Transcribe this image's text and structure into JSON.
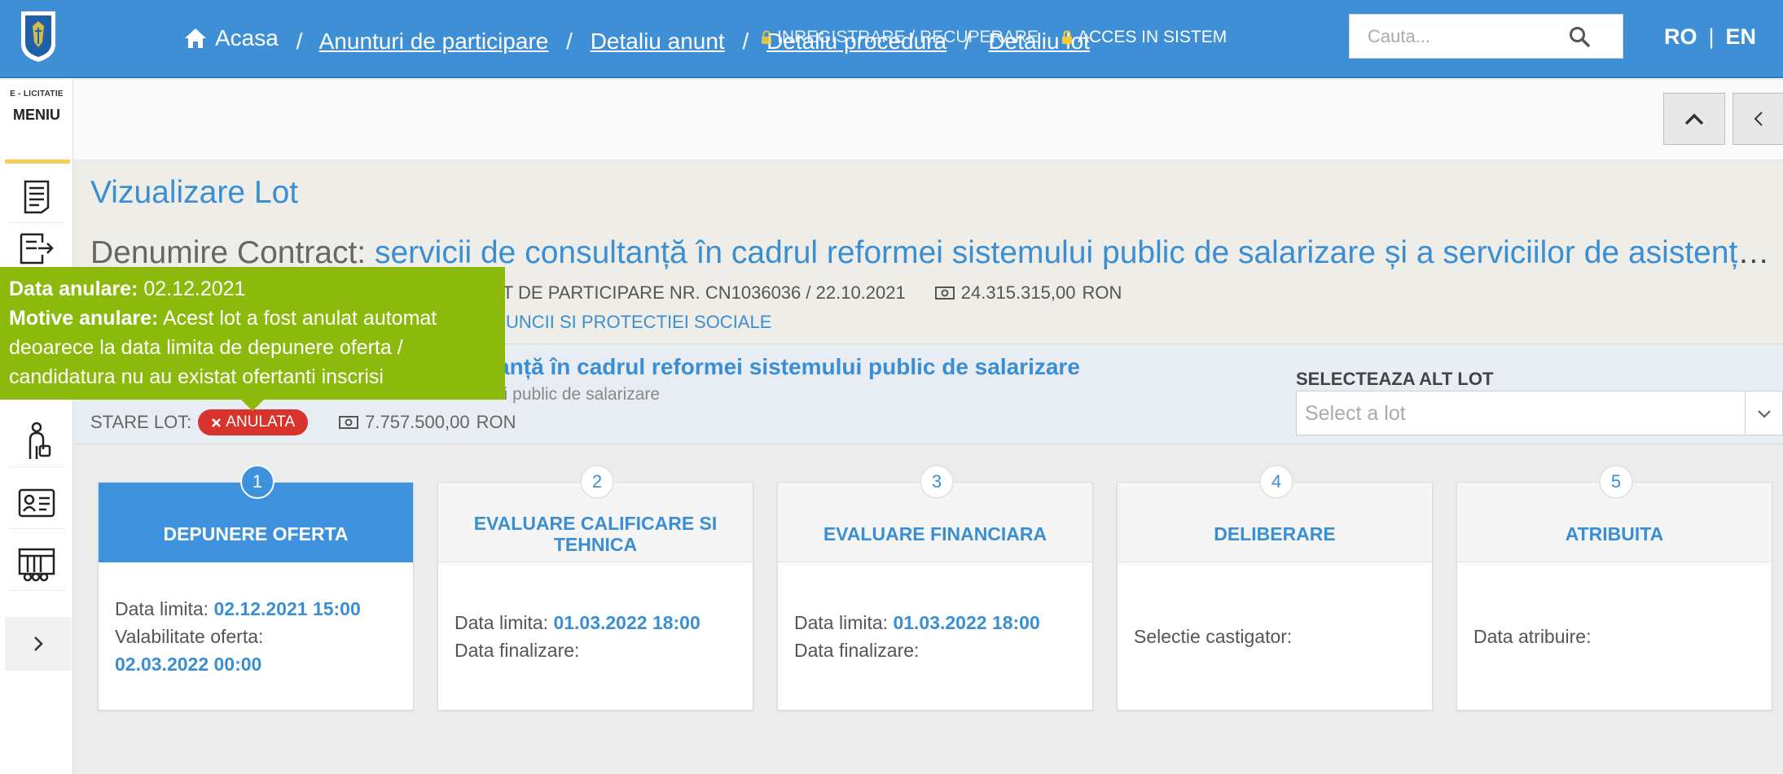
{
  "header": {
    "logo_icon": "shield-crest-logo",
    "breadcrumb": {
      "home": "Acasa",
      "items": [
        "Anunturi de participare",
        "Detaliu anunt",
        "Detaliu procedura",
        "Detaliu lot"
      ],
      "separator": "/"
    },
    "register_label": "INREGISTRARE / RECUPERARE",
    "login_label": "ACCES IN SISTEM",
    "search_placeholder": "Cauta...",
    "lang_ro": "RO",
    "lang_en": "EN",
    "lang_separator": "|",
    "accent_color": "#3e8fd6"
  },
  "sidebar": {
    "brand_small": "E - LICITATIE",
    "brand_menu": "MENIU",
    "icons": [
      "document-icon",
      "list-arrow-icon",
      "person-bag-icon",
      "id-card-icon",
      "archive-icon"
    ]
  },
  "page": {
    "title": "Vizualizare Lot",
    "contract_label": "Denumire Contract:",
    "contract_value": "servicii de consultanță în cadrul reformei sistemului public de salarizare și a serviciilor de asistență tehnică pentru implementarea proiectului",
    "notice": "NT DE PARTICIPARE NR. CN1036036 / 22.10.2021",
    "contract_amount": "24.315.315,00",
    "currency": "RON",
    "authority": "UNCII SI PROTECTIEI SOCIALE"
  },
  "lot": {
    "name": "ltanță în cadrul reformei sistemului public de salarizare",
    "subtitle": "Servicii de consultanta in cadrul reformei sistemului public de salarizare",
    "subtitle_visible": "ui public de salarizare",
    "state_label": "STARE LOT:",
    "state_value": "ANULATA",
    "state_color": "#d8332c",
    "amount": "7.757.500,00",
    "currency": "RON",
    "select_label": "SELECTEAZA ALT LOT",
    "select_placeholder": "Select a lot"
  },
  "tooltip": {
    "date_label": "Data anulare:",
    "date_value": "02.12.2021",
    "reason_label": "Motive anulare:",
    "reason_value": "Acest lot a fost anulat automat deoarece la data limita de depunere oferta / candidatura nu au existat ofertanti inscrisi",
    "color": "#8bba0d"
  },
  "stages": [
    {
      "num": "1",
      "title": "DEPUNERE OFERTA",
      "rows": [
        {
          "label": "Data limita:",
          "value": "02.12.2021 15:00"
        },
        {
          "label": "Valabilitate oferta:",
          "value": ""
        },
        {
          "label": "",
          "value": "02.03.2022 00:00"
        }
      ]
    },
    {
      "num": "2",
      "title": "EVALUARE CALIFICARE SI TEHNICA",
      "rows": [
        {
          "label": "Data limita:",
          "value": "01.03.2022 18:00"
        },
        {
          "label": "Data finalizare:",
          "value": ""
        }
      ]
    },
    {
      "num": "3",
      "title": "EVALUARE FINANCIARA",
      "rows": [
        {
          "label": "Data limita:",
          "value": "01.03.2022 18:00"
        },
        {
          "label": "Data finalizare:",
          "value": ""
        }
      ]
    },
    {
      "num": "4",
      "title": "DELIBERARE",
      "rows": [
        {
          "label": "Selectie castigator:",
          "value": ""
        }
      ]
    },
    {
      "num": "5",
      "title": "ATRIBUITA",
      "rows": [
        {
          "label": "Data atribuire:",
          "value": ""
        }
      ]
    }
  ]
}
